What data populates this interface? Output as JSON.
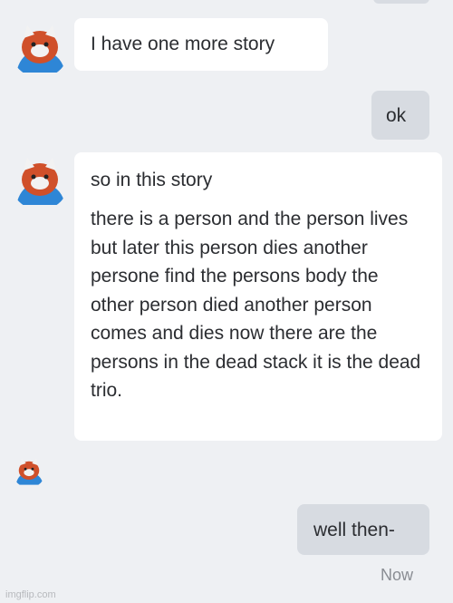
{
  "conversation": {
    "messages": [
      {
        "direction": "incoming",
        "text": "I have one more story"
      },
      {
        "direction": "outgoing",
        "text": "ok"
      },
      {
        "direction": "incoming",
        "text": "so in this story"
      },
      {
        "direction": "incoming",
        "text": "there is a person and the person lives but later this person dies another persone find the persons body the other person died another person comes and dies now there are the persons in the dead stack it is the dead trio."
      },
      {
        "direction": "outgoing",
        "text": "well then-"
      }
    ],
    "last_timestamp": "Now"
  },
  "avatar": {
    "icon": "red-panda-avatar-icon",
    "colors": {
      "fur": "#d0502a",
      "scarf": "#2e86d6",
      "ears": "#f2f2f2"
    }
  },
  "colors": {
    "background": "#eef0f3",
    "incoming_bubble": "#ffffff",
    "outgoing_bubble": "#d7dbe1",
    "text": "#2b2d31",
    "timestamp": "#8a8d93"
  },
  "watermark": "imgflip.com"
}
